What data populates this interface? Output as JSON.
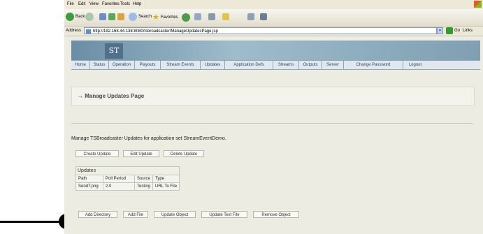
{
  "menu": [
    "File",
    "Edit",
    "View",
    "Favorites",
    "Tools",
    "Help"
  ],
  "toolbar": {
    "back": "Back",
    "search": "Search",
    "favorites": "Favorites"
  },
  "address": {
    "label": "Address",
    "url": "http://192.168.44.138:8080/tsbroadcaster/ManageUpdatesPage.jsp",
    "go": "Go",
    "links": "Links"
  },
  "logo": "ST",
  "nav": [
    "Home",
    "Status",
    "Operation",
    "Playouts",
    "Stream Events",
    "Updates",
    "Application Defs",
    "Streams",
    "Outputs",
    "Server",
    "Change Password",
    "Logout"
  ],
  "page_title": "Manage Updates Page",
  "description": "Manage TSBroadcaster Updates for application set StreamEventDemo.",
  "update_buttons": [
    "Create Update",
    "Edit Update",
    "Delete Update"
  ],
  "updates_table": {
    "caption": "Updates",
    "headers": [
      "Path",
      "Poll Period",
      "Source",
      "Type"
    ],
    "rows": [
      [
        "SendT.png",
        "2.0",
        "Testing",
        "URL To File"
      ]
    ]
  },
  "object_buttons": [
    "Add Directory",
    "Add File",
    "Update Object",
    "Update Text File",
    "Remove Object"
  ],
  "arrow_glyph": "→"
}
